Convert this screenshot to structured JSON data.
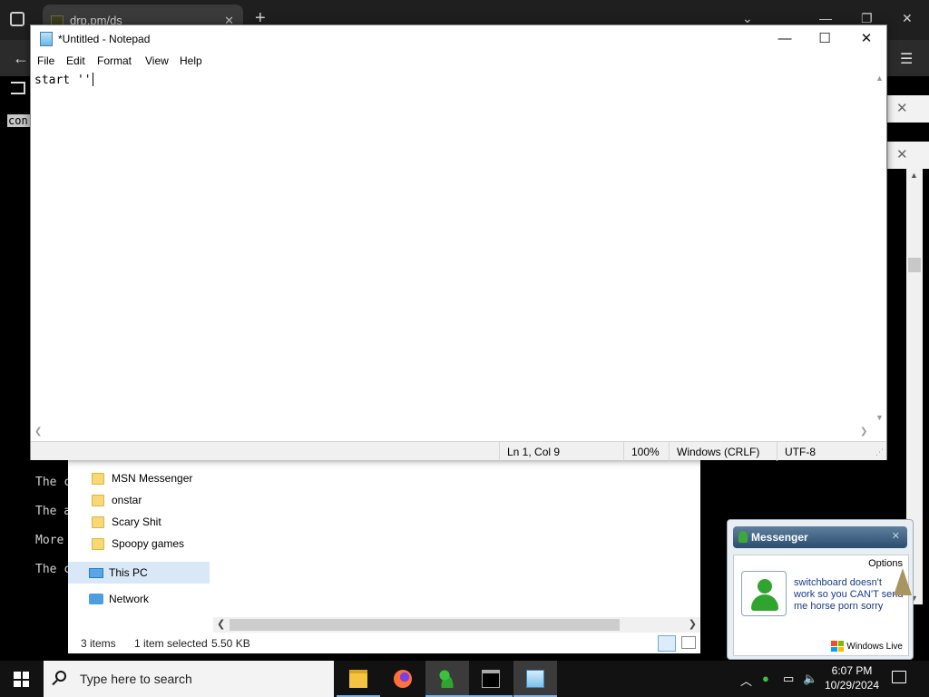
{
  "browser": {
    "tab_title": "drp.pm/ds",
    "selected_text": "con:",
    "terminal_lines": [
      "The c",
      "The a",
      "More",
      "The c"
    ]
  },
  "explorer": {
    "folders": [
      "MSN Messenger",
      "onstar",
      "Scary Shit",
      "Spoopy games"
    ],
    "this_pc": "This PC",
    "network": "Network",
    "status_items": "3 items",
    "status_selected": "1 item selected",
    "status_size": "5.50 KB"
  },
  "notepad": {
    "title": "*Untitled - Notepad",
    "menus": [
      "File",
      "Edit",
      "Format",
      "View",
      "Help"
    ],
    "text": "start ''",
    "status": {
      "position": "Ln 1, Col 9",
      "zoom": "100%",
      "line_endings": "Windows (CRLF)",
      "encoding": "UTF-8"
    }
  },
  "messenger": {
    "title": "Messenger",
    "options": "Options",
    "message": "switchboard doesn't work so you CAN'T send me horse porn sorry",
    "brand": "Windows Live"
  },
  "taskbar": {
    "search_placeholder": "Type here to search",
    "time": "6:07 PM",
    "date": "10/29/2024",
    "apps": [
      "file-explorer",
      "firefox",
      "msn-messenger",
      "terminal",
      "notepad"
    ]
  },
  "colors": {
    "msn_message": "#1a3a8a",
    "taskbar_active": "#3b3b3b",
    "taskbar_underline": "#7fb4e6"
  }
}
